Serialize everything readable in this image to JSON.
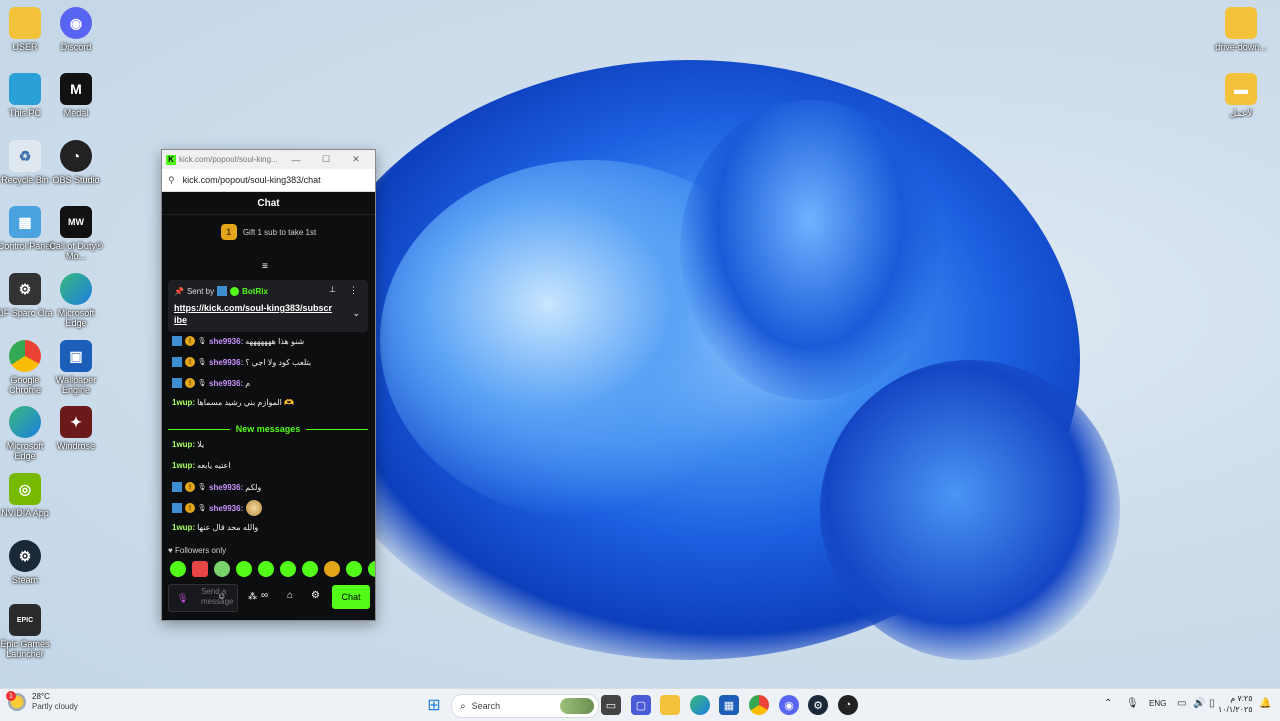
{
  "desktop": {
    "left_icons": [
      {
        "label": "USER"
      },
      {
        "label": "Discord"
      },
      {
        "label": "This PC"
      },
      {
        "label": "Medal"
      },
      {
        "label": "Recycle Bin"
      },
      {
        "label": "OBS Studio"
      },
      {
        "label": "Control Panel"
      },
      {
        "label": "Call of Duty® Mo..."
      },
      {
        "label": "DF Sparc Ora"
      },
      {
        "label": "Microsoft Edge"
      },
      {
        "label": "Google Chrome"
      },
      {
        "label": "Wallpaper Engine"
      },
      {
        "label": "Microsoft Edge"
      },
      {
        "label": "Windrose"
      },
      {
        "label": "NVIDIA App"
      },
      {
        "label": "Steam"
      },
      {
        "label": "Epic Games Launcher"
      }
    ],
    "right_icons": [
      {
        "label": "drive-down..."
      },
      {
        "label": "لاعمل"
      }
    ]
  },
  "browser": {
    "tab_title": "kick.com/popout/soul-king...",
    "url": "kick.com/popout/soul-king383/chat",
    "minimize": "—",
    "maximize": "☐",
    "close": "✕"
  },
  "chat": {
    "header": "Chat",
    "gift_count": "1",
    "gift_text": "Gift 1 sub to take 1st",
    "pinned": {
      "sent_by": "Sent by",
      "bot_name": "BotRix",
      "link": "https://kick.com/soul-king383/subscribe"
    },
    "messages": [
      {
        "user": "she9936:",
        "text": "شنو هذا هههههههه",
        "badges": true
      },
      {
        "user": "she9936:",
        "text": "بتلعب كود ولا اجي ؟",
        "badges": true
      },
      {
        "user": "she9936:",
        "text": "م",
        "badges": true
      },
      {
        "user": "1wup:",
        "text": "الموازم بني رشيد مسماها 🫶",
        "badges": false
      }
    ],
    "new_messages_label": "New messages",
    "messages_new": [
      {
        "user": "1wup:",
        "text": "يلا",
        "badges": false
      },
      {
        "user": "1wup:",
        "text": "اعتيه يابعه",
        "badges": false
      },
      {
        "user": "she9936:",
        "text": "ولكم",
        "badges": true
      },
      {
        "user": "she9936:",
        "text": "",
        "badges": true
      },
      {
        "user": "1wup:",
        "text": "والله محد قال عنها",
        "badges": false
      }
    ],
    "followers_only": "Followers only",
    "input_placeholder": "Send a message",
    "send_label": "Chat",
    "colors": {
      "accent": "#53fc18",
      "username_purple": "#c993ff",
      "username_green": "#a8ff60"
    }
  },
  "taskbar": {
    "weather_temp": "28°C",
    "weather_desc": "Partly cloudy",
    "search_placeholder": "Search",
    "lang": "ENG",
    "time": "٧:٢٥ م",
    "date": "١٠/١/٢٠٢٥"
  }
}
